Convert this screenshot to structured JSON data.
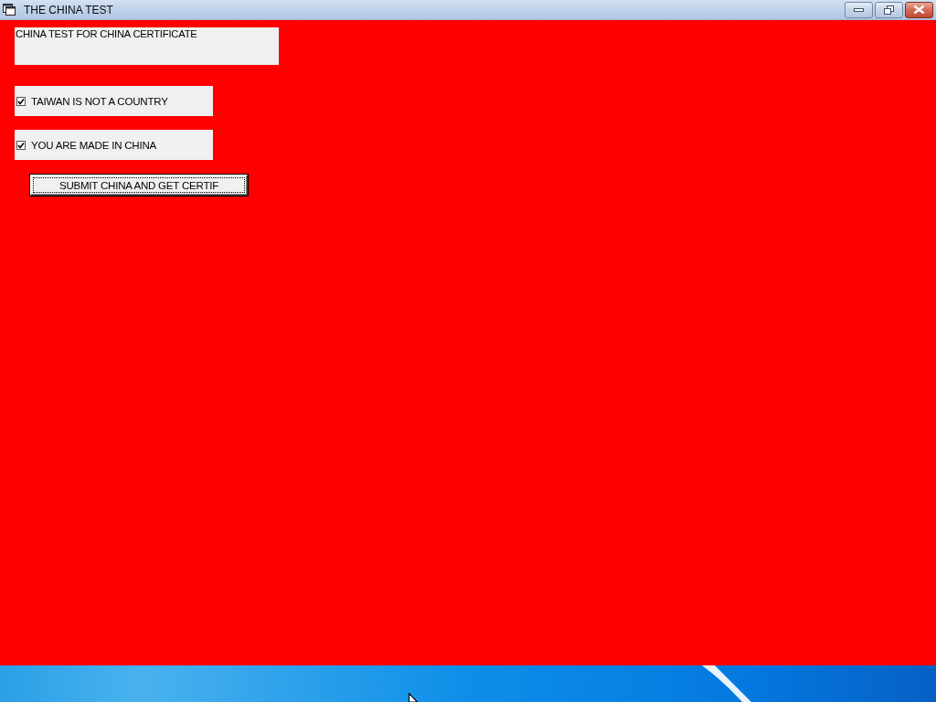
{
  "window": {
    "title": "THE CHINA TEST"
  },
  "label": {
    "text": "CHINA TEST FOR CHINA CERTIFICATE"
  },
  "checkboxes": [
    {
      "label": "TAIWAN IS NOT A COUNTRY",
      "checked": true
    },
    {
      "label": "YOU ARE MADE IN CHINA",
      "checked": true
    }
  ],
  "button": {
    "label": "SUBMIT CHINA AND GET CERTIF",
    "focused": true
  }
}
